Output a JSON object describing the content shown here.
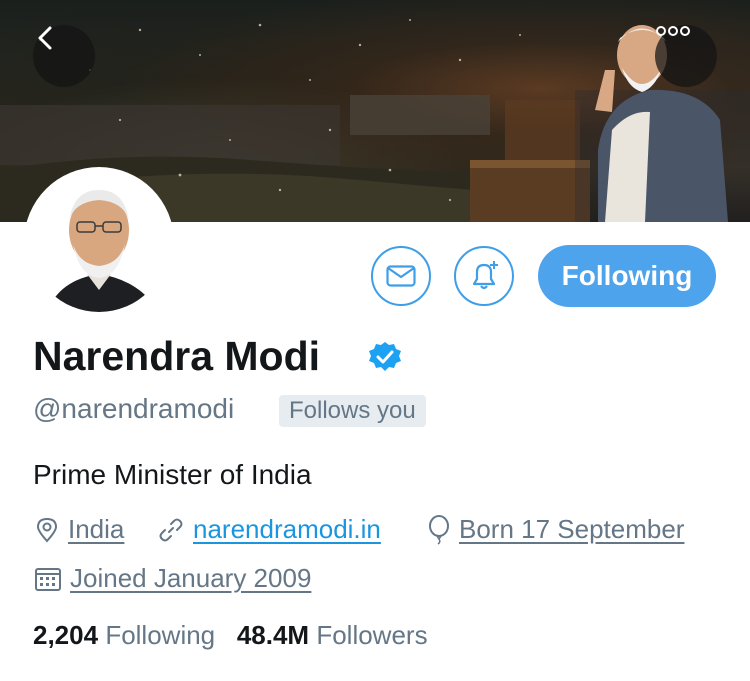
{
  "profile": {
    "name": "Narendra Modi",
    "handle": "@narendramodi",
    "follows_you": "Follows you",
    "bio": "Prime Minister of India",
    "location": "India",
    "website": "narendramodi.in",
    "birthday": "Born 17 September",
    "joined": "Joined January 2009"
  },
  "actions": {
    "following_label": "Following"
  },
  "stats": {
    "following_count": "2,204",
    "following_label": "Following",
    "followers_count": "48.4M",
    "followers_label": "Followers"
  },
  "icons": {
    "back": "chevron-left-icon",
    "more": "more-dots-icon",
    "message": "envelope-icon",
    "notify": "bell-plus-icon",
    "verified": "verified-badge-icon",
    "location": "location-pin-icon",
    "link": "link-icon",
    "birthday": "balloon-icon",
    "calendar": "calendar-icon"
  },
  "colors": {
    "accent": "#4da3ec",
    "link": "#1b95e0",
    "muted": "#657786",
    "text": "#14171a"
  }
}
